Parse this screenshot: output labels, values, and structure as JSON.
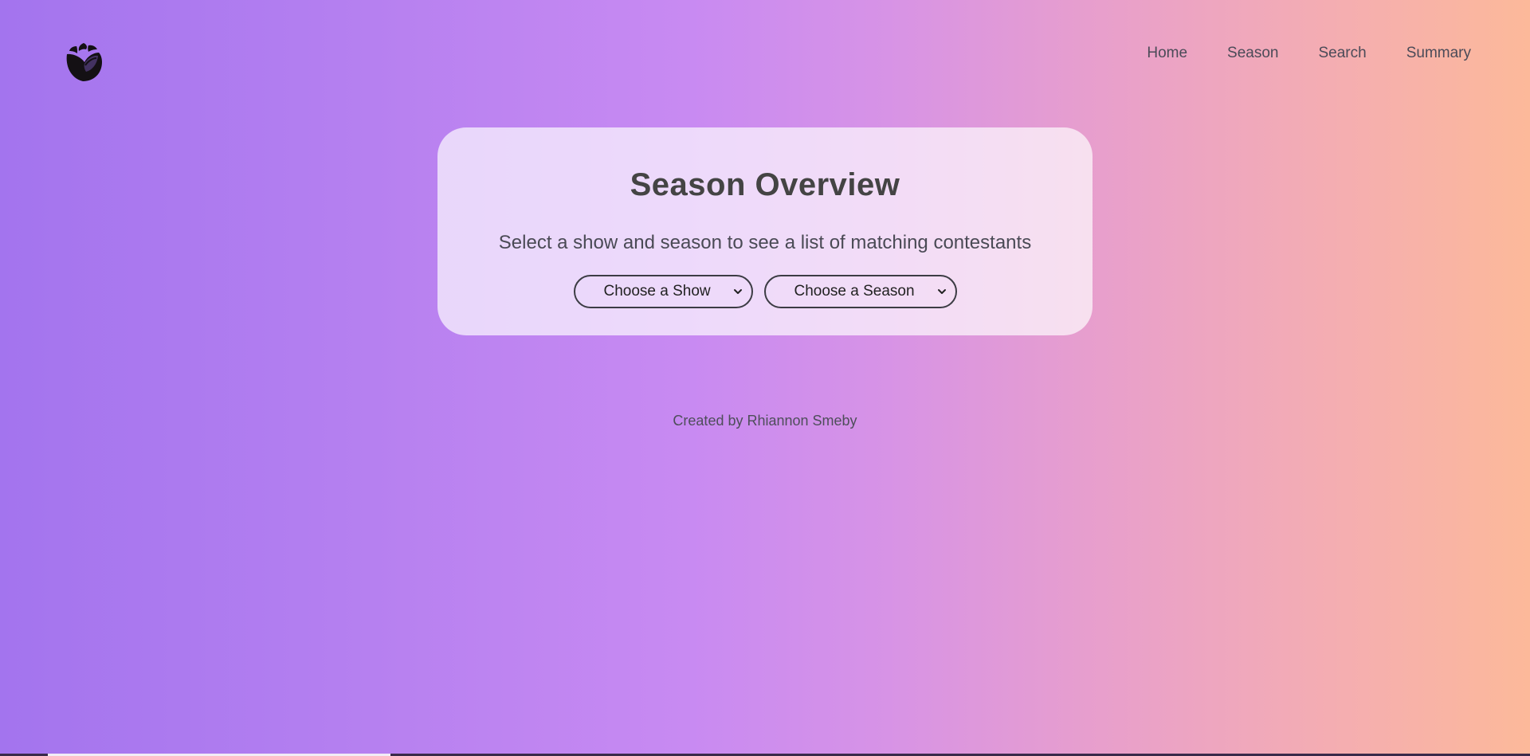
{
  "logo": {
    "icon": "rose-logo-icon"
  },
  "nav": {
    "items": [
      {
        "label": "Home"
      },
      {
        "label": "Season"
      },
      {
        "label": "Search"
      },
      {
        "label": "Summary"
      }
    ]
  },
  "card": {
    "title": "Season Overview",
    "subtitle": "Select a show and season to see a list of matching contestants",
    "show_select": {
      "selected": "Choose a Show",
      "icon": "chevron-down-icon"
    },
    "season_select": {
      "selected": "Choose a Season",
      "icon": "chevron-down-icon"
    }
  },
  "footer": {
    "text": "Created by Rhiannon Smeby"
  },
  "colors": {
    "gradient_start": "#a374ee",
    "gradient_end": "#fcb99a",
    "text": "#444444"
  }
}
